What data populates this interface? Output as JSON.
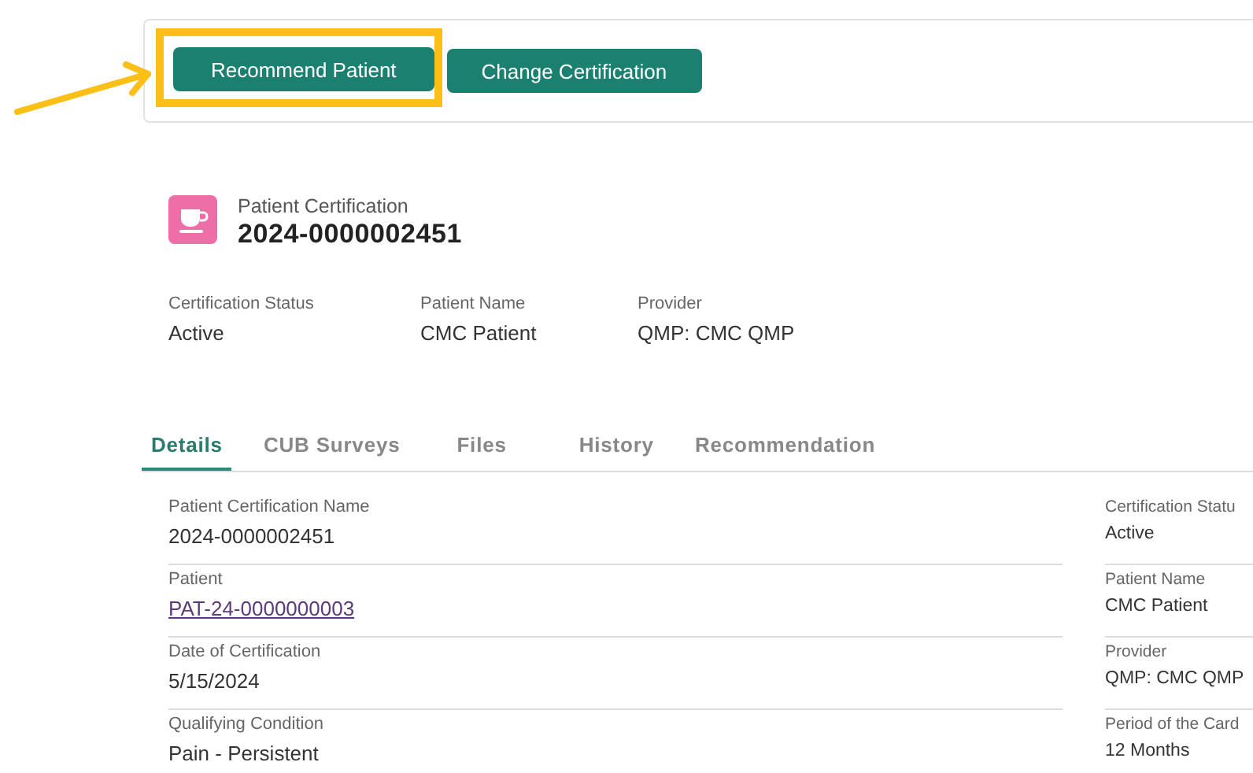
{
  "actions": [
    {
      "label": "Recommend Patient",
      "highlighted": true
    },
    {
      "label": "Change Certification",
      "highlighted": false
    }
  ],
  "record": {
    "type_label": "Patient Certification",
    "number": "2024-0000002451"
  },
  "summary": [
    {
      "label": "Certification Status",
      "value": "Active"
    },
    {
      "label": "Patient Name",
      "value": "CMC Patient"
    },
    {
      "label": "Provider",
      "value": "QMP: CMC QMP"
    }
  ],
  "tabs": [
    {
      "label": "Details",
      "selected": true
    },
    {
      "label": "CUB Surveys",
      "selected": false
    },
    {
      "label": "Files",
      "selected": false
    },
    {
      "label": "History",
      "selected": false
    },
    {
      "label": "Recommendation",
      "selected": false
    }
  ],
  "details_left": [
    {
      "label": "Patient Certification Name",
      "value": "2024-0000002451",
      "kind": "text"
    },
    {
      "label": "Patient",
      "value": "PAT-24-0000000003",
      "kind": "link"
    },
    {
      "label": "Date of Certification",
      "value": "5/15/2024",
      "kind": "text"
    },
    {
      "label": "Qualifying Condition",
      "value": "Pain - Persistent",
      "kind": "text"
    }
  ],
  "details_right": [
    {
      "label": "Certification Statu",
      "value": "Active",
      "kind": "text"
    },
    {
      "label": "Patient Name",
      "value": "CMC Patient",
      "kind": "text"
    },
    {
      "label": "Provider",
      "value": "QMP: CMC QMP",
      "kind": "text"
    },
    {
      "label": "Period of the Card",
      "value": "12 Months",
      "kind": "text"
    }
  ]
}
